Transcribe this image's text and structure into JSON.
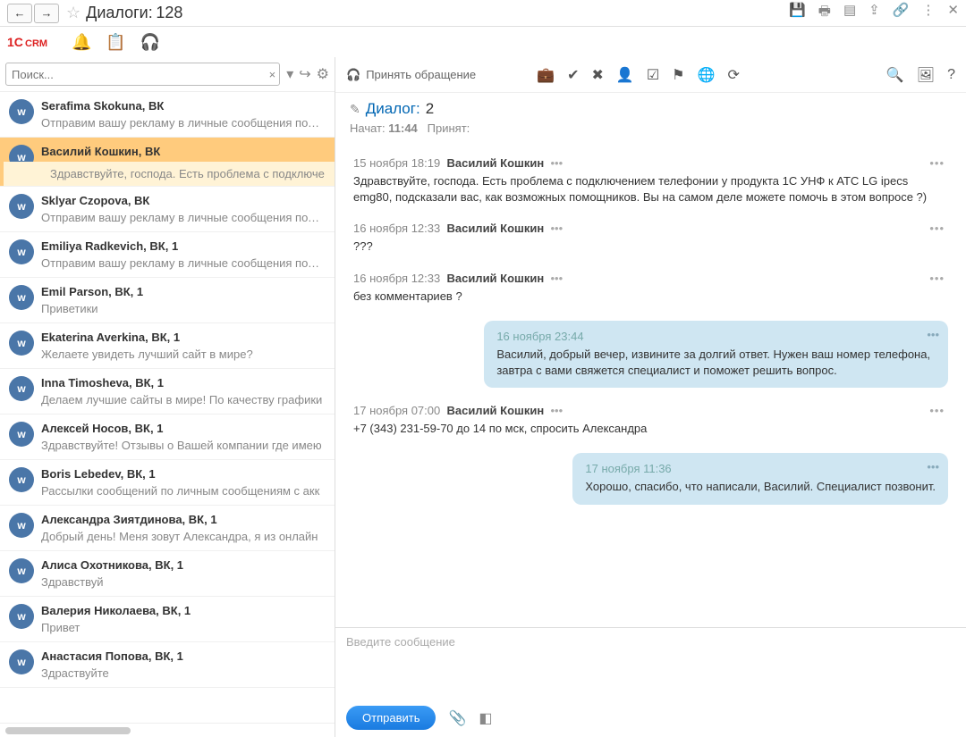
{
  "title": {
    "label": "Диалоги:",
    "count": "128"
  },
  "search": {
    "placeholder": "Поиск..."
  },
  "toolbar": {
    "accept": "Принять обращение"
  },
  "dialog": {
    "label": "Диалог:",
    "num": "2",
    "started_lbl": "Начат:",
    "started_time": "11:44",
    "accepted_lbl": "Принят:"
  },
  "compose": {
    "placeholder": "Введите сообщение",
    "send": "Отправить"
  },
  "list": [
    {
      "name": "Serafima Skokuna, ВК",
      "preview": "Отправим вашу рекламу в личные сообщения польз"
    },
    {
      "name": "Василий Кошкин, ВК",
      "preview": "Здравствуйте, господа. Есть проблема с подключе"
    },
    {
      "name": "Sklyar Czopova, ВК",
      "preview": "Отправим вашу рекламу в личные сообщения польз"
    },
    {
      "name": "Emiliya Radkevich, ВК, 1",
      "preview": "Отправим вашу рекламу в личные сообщения польз"
    },
    {
      "name": "Emil Parson, ВК, 1",
      "preview": "Приветики"
    },
    {
      "name": "Ekaterina Averkina, ВК, 1",
      "preview": "Желаете увидеть лучший сайт в мире?"
    },
    {
      "name": "Inna Timosheva, ВК, 1",
      "preview": "Делаем лучшие сайты в мире! По качеству графики"
    },
    {
      "name": "Алексей Носов, ВК, 1",
      "preview": "Здравствуйте! Отзывы о Вашей компании где имею"
    },
    {
      "name": "Boris Lebedev, ВК, 1",
      "preview": "Рассылки сообщений по личным сообщениям с акк"
    },
    {
      "name": "Александра Зиятдинова, ВК, 1",
      "preview": "Добрый день! Меня зовут Александра, я из онлайн"
    },
    {
      "name": "Алиса Охотникова, ВК, 1",
      "preview": "Здравствуй"
    },
    {
      "name": "Валерия Николаева, ВК, 1",
      "preview": "Привет"
    },
    {
      "name": "Анастасия Попова, ВК, 1",
      "preview": "Здраствуйте"
    }
  ],
  "messages": [
    {
      "dir": "in",
      "date": "15 ноября 18:19",
      "author": "Василий Кошкин",
      "text": "Здравствуйте, господа. Есть проблема с подключением телефонии у продукта 1С УНФ к АТС LG ipecs emg80, подсказали вас, как возможных помощников. Вы на самом деле можете помочь в этом вопросе ?)"
    },
    {
      "dir": "in",
      "date": "16 ноября 12:33",
      "author": "Василий Кошкин",
      "text": "???"
    },
    {
      "dir": "in",
      "date": "16 ноября 12:33",
      "author": "Василий Кошкин",
      "text": "без комментариев ?"
    },
    {
      "dir": "out",
      "date": "16 ноября 23:44",
      "text": "Василий, добрый вечер, извините за долгий ответ. Нужен ваш номер телефона, завтра с вами свяжется специалист и поможет решить вопрос."
    },
    {
      "dir": "in",
      "date": "17 ноября 07:00",
      "author": "Василий Кошкин",
      "text": "+7 (343) 231-59-70 до 14 по мск, спросить Александра"
    },
    {
      "dir": "out",
      "date": "17 ноября 11:36",
      "text": "Хорошо, спасибо, что написали, Василий. Специалист позвонит."
    }
  ]
}
